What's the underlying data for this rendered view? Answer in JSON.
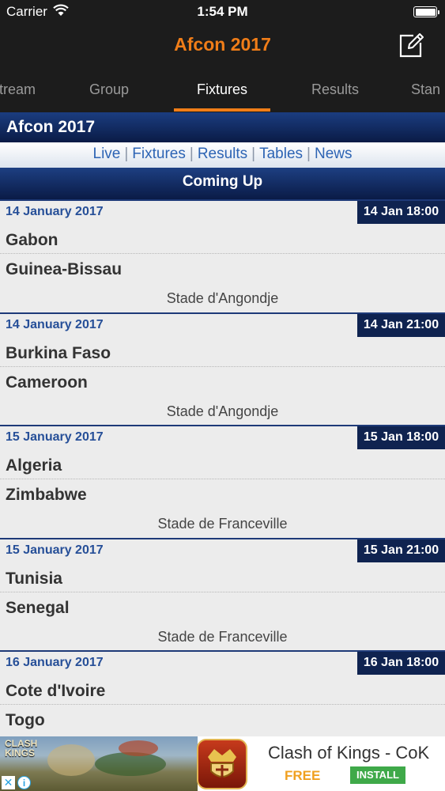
{
  "status_bar": {
    "carrier": "Carrier",
    "time": "1:54 PM"
  },
  "nav": {
    "title": "Afcon 2017",
    "compose_icon": "compose-icon"
  },
  "tabs": [
    {
      "label": "tream"
    },
    {
      "label": "Group"
    },
    {
      "label": "Fixtures",
      "active": true
    },
    {
      "label": "Results"
    },
    {
      "label": "Stan"
    }
  ],
  "site": {
    "title": "Afcon 2017",
    "links": [
      "Live",
      "Fixtures",
      "Results",
      "Tables",
      "News"
    ],
    "separator": "|"
  },
  "section": {
    "coming_up": "Coming Up"
  },
  "fixtures": [
    {
      "date": "14 January 2017",
      "time": "14 Jan 18:00",
      "home": "Gabon",
      "away": "Guinea-Bissau",
      "venue": "Stade d'Angondje"
    },
    {
      "date": "14 January 2017",
      "time": "14 Jan 21:00",
      "home": "Burkina Faso",
      "away": "Cameroon",
      "venue": "Stade d'Angondje"
    },
    {
      "date": "15 January 2017",
      "time": "15 Jan 18:00",
      "home": "Algeria",
      "away": "Zimbabwe",
      "venue": "Stade de Franceville"
    },
    {
      "date": "15 January 2017",
      "time": "15 Jan 21:00",
      "home": "Tunisia",
      "away": "Senegal",
      "venue": "Stade de Franceville"
    },
    {
      "date": "16 January 2017",
      "time": "16 Jan 18:00",
      "home": "Cote d'Ivoire",
      "away": "Togo",
      "venue": ""
    }
  ],
  "ad": {
    "title": "Clash of Kings - CoK",
    "free_label": "FREE",
    "install_label": "INSTALL",
    "art_logo_line1": "CLASH",
    "art_logo_line2": "KINGS",
    "close_glyph": "✕",
    "info_glyph": "i"
  },
  "colors": {
    "accent_orange": "#f07d18",
    "header_navy": "#0f2350",
    "link_blue": "#2d64b4",
    "date_blue": "#264f98",
    "install_green": "#3fa949"
  }
}
